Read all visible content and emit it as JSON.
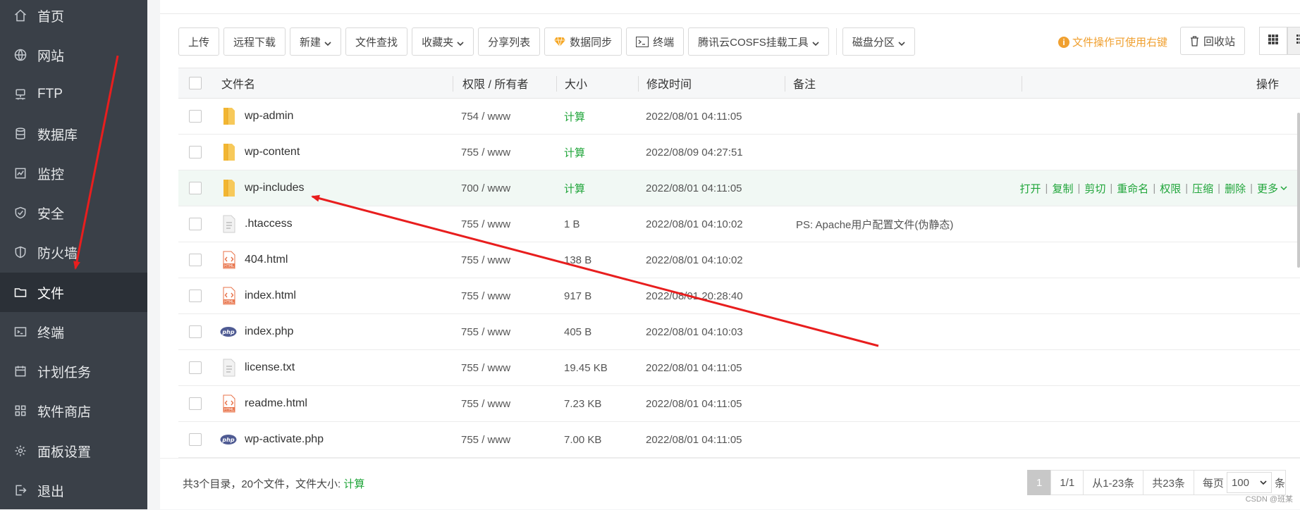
{
  "sidebar": {
    "items": [
      {
        "label": "首页",
        "icon": "home-icon"
      },
      {
        "label": "网站",
        "icon": "globe-icon"
      },
      {
        "label": "FTP",
        "icon": "ftp-icon"
      },
      {
        "label": "数据库",
        "icon": "database-icon"
      },
      {
        "label": "监控",
        "icon": "monitor-icon"
      },
      {
        "label": "安全",
        "icon": "shield-icon"
      },
      {
        "label": "防火墙",
        "icon": "firewall-icon"
      },
      {
        "label": "文件",
        "icon": "folder-icon",
        "active": true
      },
      {
        "label": "终端",
        "icon": "terminal-icon"
      },
      {
        "label": "计划任务",
        "icon": "calendar-icon"
      },
      {
        "label": "软件商店",
        "icon": "apps-icon"
      },
      {
        "label": "面板设置",
        "icon": "gear-icon"
      },
      {
        "label": "退出",
        "icon": "logout-icon"
      }
    ]
  },
  "toolbar": {
    "upload": "上传",
    "remote_download": "远程下载",
    "new": "新建",
    "file_search": "文件查找",
    "favorites": "收藏夹",
    "share_list": "分享列表",
    "data_sync": "数据同步",
    "terminal": "终端",
    "cosfs": "腾讯云COSFS挂载工具",
    "disk_partition": "磁盘分区",
    "hint": "文件操作可使用右键",
    "recycle_bin": "回收站"
  },
  "table": {
    "headers": {
      "name": "文件名",
      "perm": "权限 / 所有者",
      "size": "大小",
      "mtime": "修改时间",
      "note": "备注",
      "ops": "操作"
    },
    "rows": [
      {
        "name": "wp-admin",
        "type": "folder",
        "perm": "754 / www",
        "size": "计算",
        "mtime": "2022/08/01 04:11:05",
        "note": ""
      },
      {
        "name": "wp-content",
        "type": "folder",
        "perm": "755 / www",
        "size": "计算",
        "mtime": "2022/08/09 04:27:51",
        "note": ""
      },
      {
        "name": "wp-includes",
        "type": "folder",
        "perm": "700 / www",
        "size": "计算",
        "mtime": "2022/08/01 04:11:05",
        "note": ""
      },
      {
        "name": ".htaccess",
        "type": "text",
        "perm": "755 / www",
        "size": "1 B",
        "mtime": "2022/08/01 04:10:02",
        "note": "PS: Apache用户配置文件(伪静态)"
      },
      {
        "name": "404.html",
        "type": "html",
        "perm": "755 / www",
        "size": "138 B",
        "mtime": "2022/08/01 04:10:02",
        "note": ""
      },
      {
        "name": "index.html",
        "type": "html",
        "perm": "755 / www",
        "size": "917 B",
        "mtime": "2022/08/01 20:28:40",
        "note": ""
      },
      {
        "name": "index.php",
        "type": "php",
        "perm": "755 / www",
        "size": "405 B",
        "mtime": "2022/08/01 04:10:03",
        "note": ""
      },
      {
        "name": "license.txt",
        "type": "text",
        "perm": "755 / www",
        "size": "19.45 KB",
        "mtime": "2022/08/01 04:11:05",
        "note": ""
      },
      {
        "name": "readme.html",
        "type": "html",
        "perm": "755 / www",
        "size": "7.23 KB",
        "mtime": "2022/08/01 04:11:05",
        "note": ""
      },
      {
        "name": "wp-activate.php",
        "type": "php",
        "perm": "755 / www",
        "size": "7.00 KB",
        "mtime": "2022/08/01 04:11:05",
        "note": ""
      }
    ],
    "hover_ops": [
      "打开",
      "复制",
      "剪切",
      "重命名",
      "权限",
      "压缩",
      "删除",
      "更多"
    ]
  },
  "footer": {
    "summary": "共3个目录，20个文件，文件大小:",
    "calc": "计算",
    "page_current": "1",
    "page_total": "1/1",
    "range": "从1-23条",
    "total": "共23条",
    "per_page_label": "每页",
    "per_page": "100",
    "per_page_suffix": "条"
  },
  "watermark": "CSDN @班某",
  "colors": {
    "sidebar_bg": "#3a4048",
    "sidebar_active": "#2b3037",
    "accent_green": "#20a53a",
    "hint_orange": "#f0a030",
    "annotation_red": "#e81e1e"
  }
}
